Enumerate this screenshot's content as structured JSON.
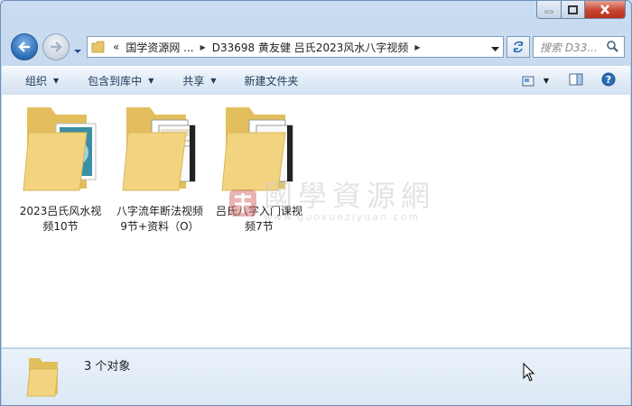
{
  "window": {
    "controls": {
      "minimize_icon": "minimize-icon",
      "maximize_icon": "maximize-icon",
      "close_icon": "close-icon"
    }
  },
  "address_bar": {
    "overflow_marker": "«",
    "breadcrumbs": [
      "国学资源网 ...",
      "D33698 黄友健 吕氏2023风水八字视频"
    ]
  },
  "search": {
    "placeholder": "搜索 D33..."
  },
  "toolbar": {
    "organize": "组织",
    "include_in_library": "包含到库中",
    "share": "共享",
    "new_folder": "新建文件夹"
  },
  "items": [
    {
      "line1": "2023吕氏风水视",
      "line2": "频10节",
      "preview_color": "#3a8fa3"
    },
    {
      "line1": "八字流年断法视频",
      "line2": "9节+资料（O）",
      "preview_color": "#e9e1cf"
    },
    {
      "line1": "吕氏八字入门课视",
      "line2": "频7节",
      "preview_color": "#e0473a"
    }
  ],
  "watermark": {
    "title": "國學資源網",
    "url": "www.guoxueziyuan.com"
  },
  "details": {
    "count": "3 个对象"
  },
  "colors": {
    "folder": "#f2d480",
    "folder_dark": "#d9b75a",
    "accent": "#2a6db5"
  }
}
